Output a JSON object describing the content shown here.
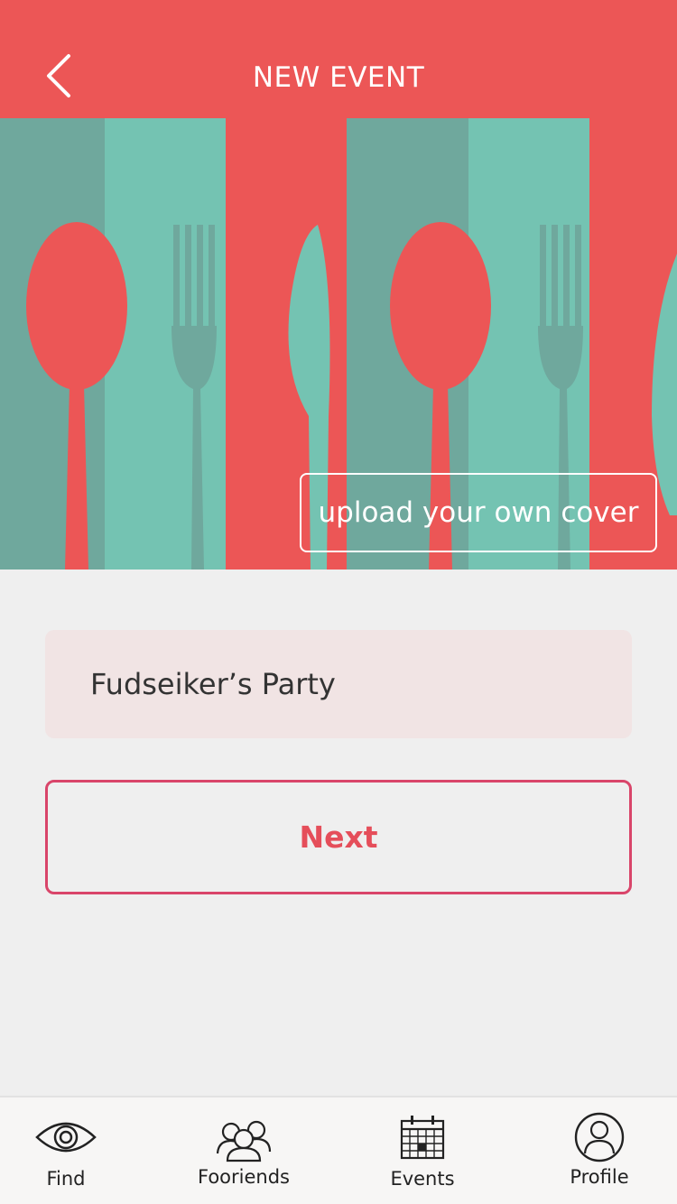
{
  "header": {
    "title": "NEW EVENT",
    "back_icon": "chevron-left-icon"
  },
  "cover": {
    "upload_label": "upload your own cover",
    "colors": {
      "red": "#ec5656",
      "teal": "#74c3b2",
      "dark_teal": "#6fa89d"
    }
  },
  "form": {
    "event_name_value": "Fudseiker’s Party",
    "next_label": "Next"
  },
  "tabbar": {
    "items": [
      {
        "label": "Find",
        "icon": "eye-icon"
      },
      {
        "label": "Fooriends",
        "icon": "friends-icon"
      },
      {
        "label": "Events",
        "icon": "calendar-icon"
      },
      {
        "label": "Profile",
        "icon": "profile-icon"
      }
    ]
  }
}
